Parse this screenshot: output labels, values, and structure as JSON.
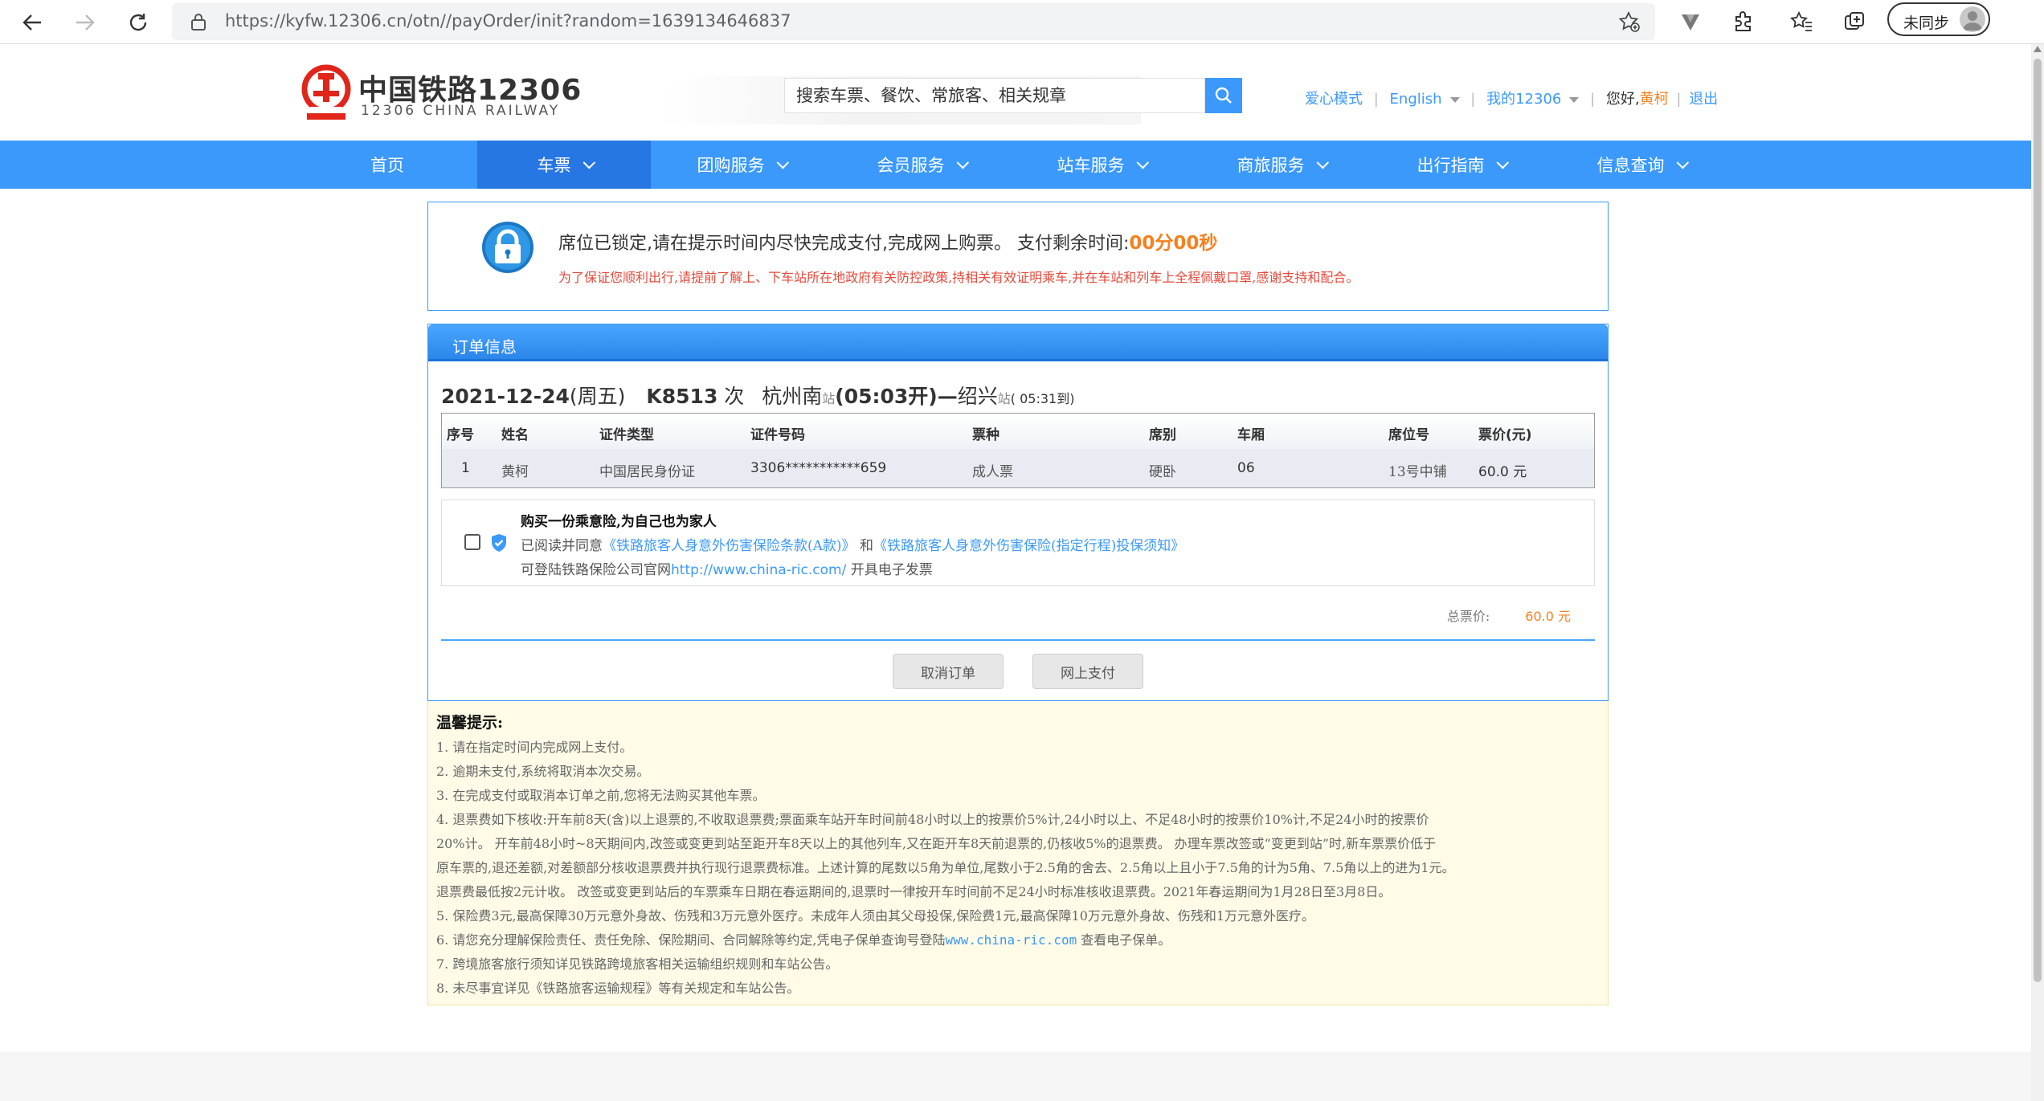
{
  "browser": {
    "url": "https://kyfw.12306.cn/otn//payOrder/init?random=1639134646837",
    "profile_label": "未同步",
    "icons": [
      "back-icon",
      "forward-icon",
      "refresh-icon",
      "lock-icon",
      "add-favorite-icon",
      "extension-v-icon",
      "extensions-puzzle-icon",
      "favorites-icon",
      "collections-icon",
      "profile-avatar-icon"
    ]
  },
  "header": {
    "logo_cn": "中国铁路12306",
    "logo_en": "12306 CHINA RAILWAY",
    "search_placeholder": "搜索车票、餐饮、常旅客、相关规章",
    "links": {
      "care_mode": "爱心模式",
      "language": "English",
      "my12306": "我的12306",
      "greeting": "您好,",
      "user": "黄柯",
      "logout": "退出"
    }
  },
  "nav": {
    "items": [
      {
        "label": "首页"
      },
      {
        "label": "车票"
      },
      {
        "label": "团购服务"
      },
      {
        "label": "会员服务"
      },
      {
        "label": "站车服务"
      },
      {
        "label": "商旅服务"
      },
      {
        "label": "出行指南"
      },
      {
        "label": "信息查询"
      }
    ],
    "active_index": 1
  },
  "notice": {
    "main": "席位已锁定,请在提示时间内尽快完成支付,完成网上购票。 支付剩余时间:",
    "countdown": "00分00秒",
    "warning": "为了保证您顺利出行,请提前了解上、下车站所在地政府有关防控政策,持相关有效证明乘车,并在车站和列车上全程佩戴口罩,感谢支持和配合。"
  },
  "order": {
    "panel_title": "订单信息",
    "date": "2021-12-24",
    "weekday": "(周五)",
    "train": "K8513",
    "train_suffix": "次",
    "from": "杭州南",
    "station_suffix": "站",
    "depart": "(05:03开)",
    "dash": "—",
    "to": "绍兴",
    "arrive": "( 05:31到)",
    "columns": [
      "序号",
      "姓名",
      "证件类型",
      "证件号码",
      "票种",
      "席别",
      "车厢",
      "席位号",
      "票价(元)"
    ],
    "rows": [
      [
        "1",
        "黄柯",
        "中国居民身份证",
        "3306***********659",
        "成人票",
        "硬卧",
        "06",
        "13号中铺",
        "60.0 元"
      ]
    ],
    "insurance": {
      "title": "购买一份乘意险,为自己也为家人",
      "read_prefix": "已阅读并同意",
      "terms_link": "《铁路旅客人身意外伤害保险条款(A款)》",
      "and": "和",
      "notice_link": "《铁路旅客人身意外伤害保险(指定行程)投保须知》",
      "invoice_prefix": "可登陆铁路保险公司官网",
      "invoice_url": "http://www.china-ric.com/",
      "invoice_suffix": " 开具电子发票",
      "checked": false
    },
    "total_label": "总票价:",
    "total_value": "60.0 元",
    "cancel_button": "取消订单",
    "pay_button": "网上支付"
  },
  "tips": {
    "title": "温馨提示:",
    "lines": [
      "1. 请在指定时间内完成网上支付。",
      "2. 逾期未支付,系统将取消本次交易。",
      "3. 在完成支付或取消本订单之前,您将无法购买其他车票。",
      "4. 退票费如下核收:开车前8天(含)以上退票的,不收取退票费;票面乘车站开车时间前48小时以上的按票价5%计,24小时以上、不足48小时的按票价10%计,不足24小时的按票价",
      "20%计。 开车前48小时~8天期间内,改签或变更到站至距开车8天以上的其他列车,又在距开车8天前退票的,仍核收5%的退票费。 办理车票改签或“变更到站”时,新车票票价低于",
      "原车票的,退还差额,对差额部分核收退票费并执行现行退票费标准。上述计算的尾数以5角为单位,尾数小于2.5角的舍去、2.5角以上且小于7.5角的计为5角、7.5角以上的进为1元。",
      "退票费最低按2元计收。 改签或变更到站后的车票乘车日期在春运期间的,退票时一律按开车时间前不足24小时标准核收退票费。2021年春运期间为1月28日至3月8日。",
      "5. 保险费3元,最高保障30万元意外身故、伤残和3万元意外医疗。未成年人须由其父母投保,保险费1元,最高保障10万元意外身故、伤残和1万元意外医疗。",
      "6. 请您充分理解保险责任、责任免除、保险期间、合同解除等约定,凭电子保单查询号登陆",
      "7. 跨境旅客旅行须知详见铁路跨境旅客相关运输组织规则和车站公告。",
      "8. 未尽事宜详见《铁路旅客运输规程》等有关规定和车站公告。"
    ],
    "line6_link": "www.china-ric.com",
    "line6_suffix": " 查看电子保单。"
  },
  "colors": {
    "brand_blue": "#3b99fc",
    "nav_active": "#2676e3",
    "accent_orange": "#f5811f",
    "warning_red": "#e64a3b",
    "tips_bg": "#fffbe7"
  }
}
